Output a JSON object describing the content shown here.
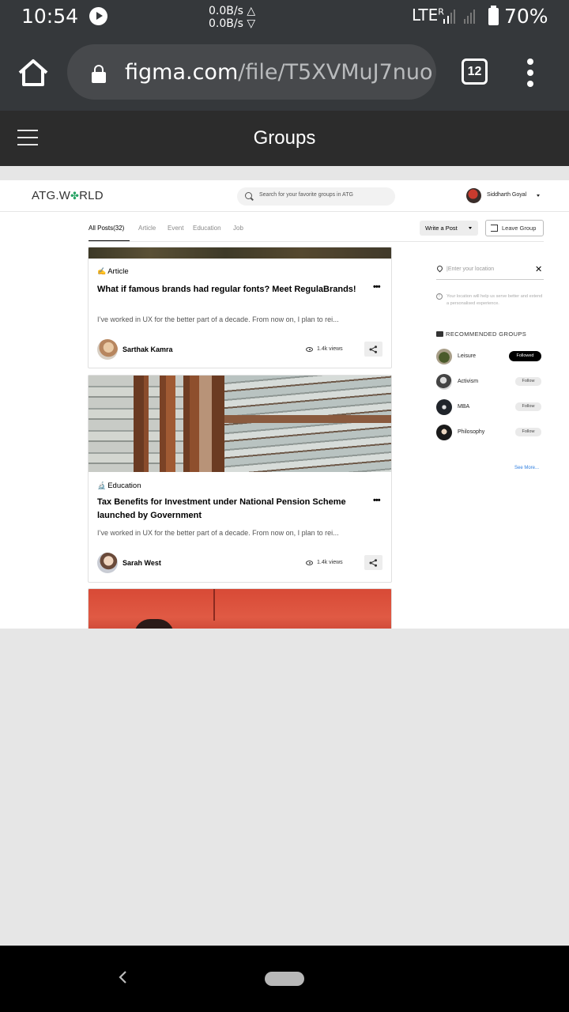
{
  "status_bar": {
    "time": "10:54",
    "net_up": "0.0B/s △",
    "net_down": "0.0B/s ▽",
    "network": "LTE",
    "roaming": "R",
    "battery": "70%"
  },
  "browser": {
    "url_domain": "figma.com",
    "url_path": "/file/T5XVMuJ7nuo",
    "tab_count": "12"
  },
  "figma": {
    "title": "Groups"
  },
  "site": {
    "logo_prefix": "ATG.W",
    "logo_suffix": "RLD",
    "search_placeholder": "Search for your favorite groups in ATG",
    "user_name": "Siddharth Goyal"
  },
  "tabs": [
    {
      "label": "All Posts(32)",
      "active": true
    },
    {
      "label": "Article"
    },
    {
      "label": "Event"
    },
    {
      "label": "Education"
    },
    {
      "label": "Job"
    }
  ],
  "actions": {
    "write_post": "Write a Post",
    "leave_group": "Leave Group"
  },
  "posts": [
    {
      "category": "Article",
      "category_icon": "✍",
      "title": "What if famous brands had regular fonts? Meet RegulaBrands!",
      "excerpt": "I’ve worked in UX for the better part of a decade. From now on, I plan to rei...",
      "author": "Sarthak Kamra",
      "views": "1.4k views"
    },
    {
      "category": "Education",
      "category_icon": "🔬",
      "title": "Tax Benefits for Investment under National Pension Scheme launched by Government",
      "excerpt": "I’ve worked in UX for the better part of a decade. From now on, I plan to rei...",
      "author": "Sarah West",
      "views": "1.4k views"
    }
  ],
  "sidebar": {
    "location_placeholder": "|Enter your location",
    "location_info": "Your location will help us serve better and extend a personalised experience.",
    "recommended_heading": "RECOMMENDED GROUPS",
    "groups": [
      {
        "name": "Leisure",
        "button": "Followed",
        "followed": true
      },
      {
        "name": "Activism",
        "button": "Follow"
      },
      {
        "name": "MBA",
        "button": "Follow"
      },
      {
        "name": "Philosophy",
        "button": "Follow"
      }
    ],
    "see_more": "See More..."
  }
}
